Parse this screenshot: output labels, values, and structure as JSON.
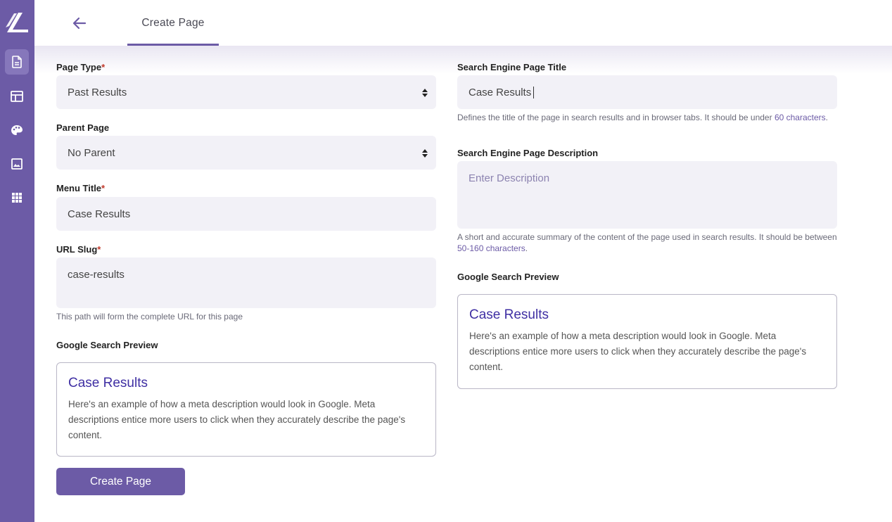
{
  "sidebar": {
    "icons": [
      "logo-icon",
      "document-icon",
      "table-icon",
      "palette-icon",
      "image-icon",
      "grid-icon"
    ],
    "active": "document-icon",
    "color": "#6c5ba6"
  },
  "header": {
    "tab_label": "Create Page"
  },
  "form": {
    "page_type": {
      "label": "Page Type",
      "value": "Past Results",
      "required": "*"
    },
    "parent_page": {
      "label": "Parent Page",
      "value": "No Parent"
    },
    "menu_title": {
      "label": "Menu Title",
      "value": "Case Results",
      "required": "*"
    },
    "url_slug": {
      "label": "URL Slug",
      "value": "case-results",
      "required": "*",
      "help": "This path will form the complete URL for this page"
    },
    "seo_title": {
      "label": "Search Engine Page Title",
      "value": "Case Results",
      "help_prefix": "Defines the title of the page in search results and in browser tabs. It should be under ",
      "help_link": "60 characters",
      "help_suffix": "."
    },
    "seo_description": {
      "label": "Search Engine Page Description",
      "placeholder": "Enter Description",
      "help_prefix": "A short and accurate summary of the content of the page used in search results. It should be between ",
      "help_link": "50-160 characters",
      "help_suffix": "."
    }
  },
  "preview_left": {
    "label": "Google Search Preview",
    "title": "Case Results",
    "description": "Here's an example of how a meta description would look in Google. Meta descriptions entice more users to click when they accurately describe the page's content."
  },
  "preview_right": {
    "label": "Google Search Preview",
    "title": "Case Results",
    "description": "Here's an example of how a meta description would look in Google. Meta descriptions entice more users to click when they accurately describe the page's content."
  },
  "actions": {
    "create_label": "Create Page"
  }
}
